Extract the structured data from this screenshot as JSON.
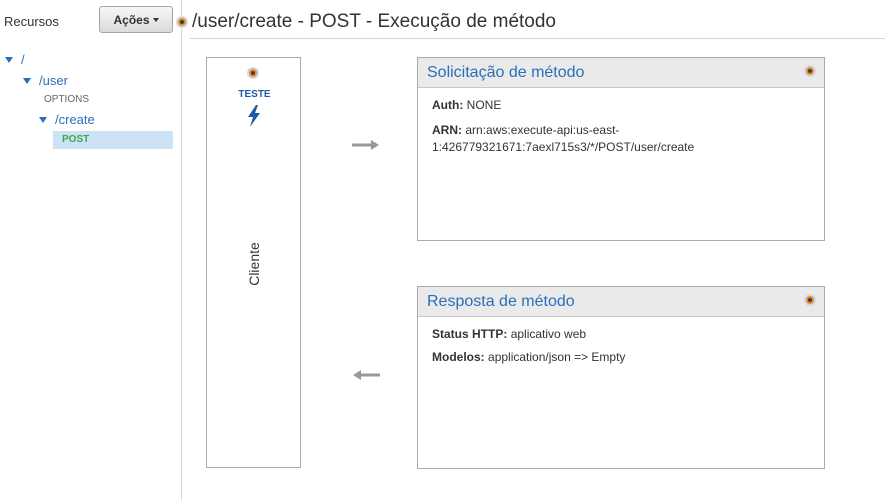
{
  "sidebar": {
    "title": "Recursos",
    "actions_label": "Ações",
    "tree": {
      "root": "/",
      "user": "/user",
      "options": "OPTIONS",
      "create": "/create",
      "post": "POST"
    }
  },
  "page": {
    "title": "/user/create - POST - Execução de método"
  },
  "client": {
    "test_label": "TESTE",
    "label": "Cliente"
  },
  "request_panel": {
    "title": "Solicitação de método",
    "auth_label": "Auth:",
    "auth_value": "NONE",
    "arn_label": "ARN:",
    "arn_value_line1": "arn:aws:execute-api:us-east-",
    "arn_value_line2": "1:426779321671:7aexl715s3/*/POST/user/create"
  },
  "response_panel": {
    "title": "Resposta de método",
    "status_label": "Status HTTP:",
    "status_value": "aplicativo web",
    "models_label": "Modelos:",
    "models_value": "application/json => Empty"
  },
  "colors": {
    "link": "#2a6ebb",
    "post_method": "#3aaa4a",
    "selection_bg": "#cde2f5",
    "help_dot": "#f28b1e"
  },
  "icons": {
    "help": "help-dot-icon",
    "test": "lightning-bolt-icon",
    "arrow_right": "arrow-right-icon",
    "arrow_left": "arrow-left-icon"
  }
}
